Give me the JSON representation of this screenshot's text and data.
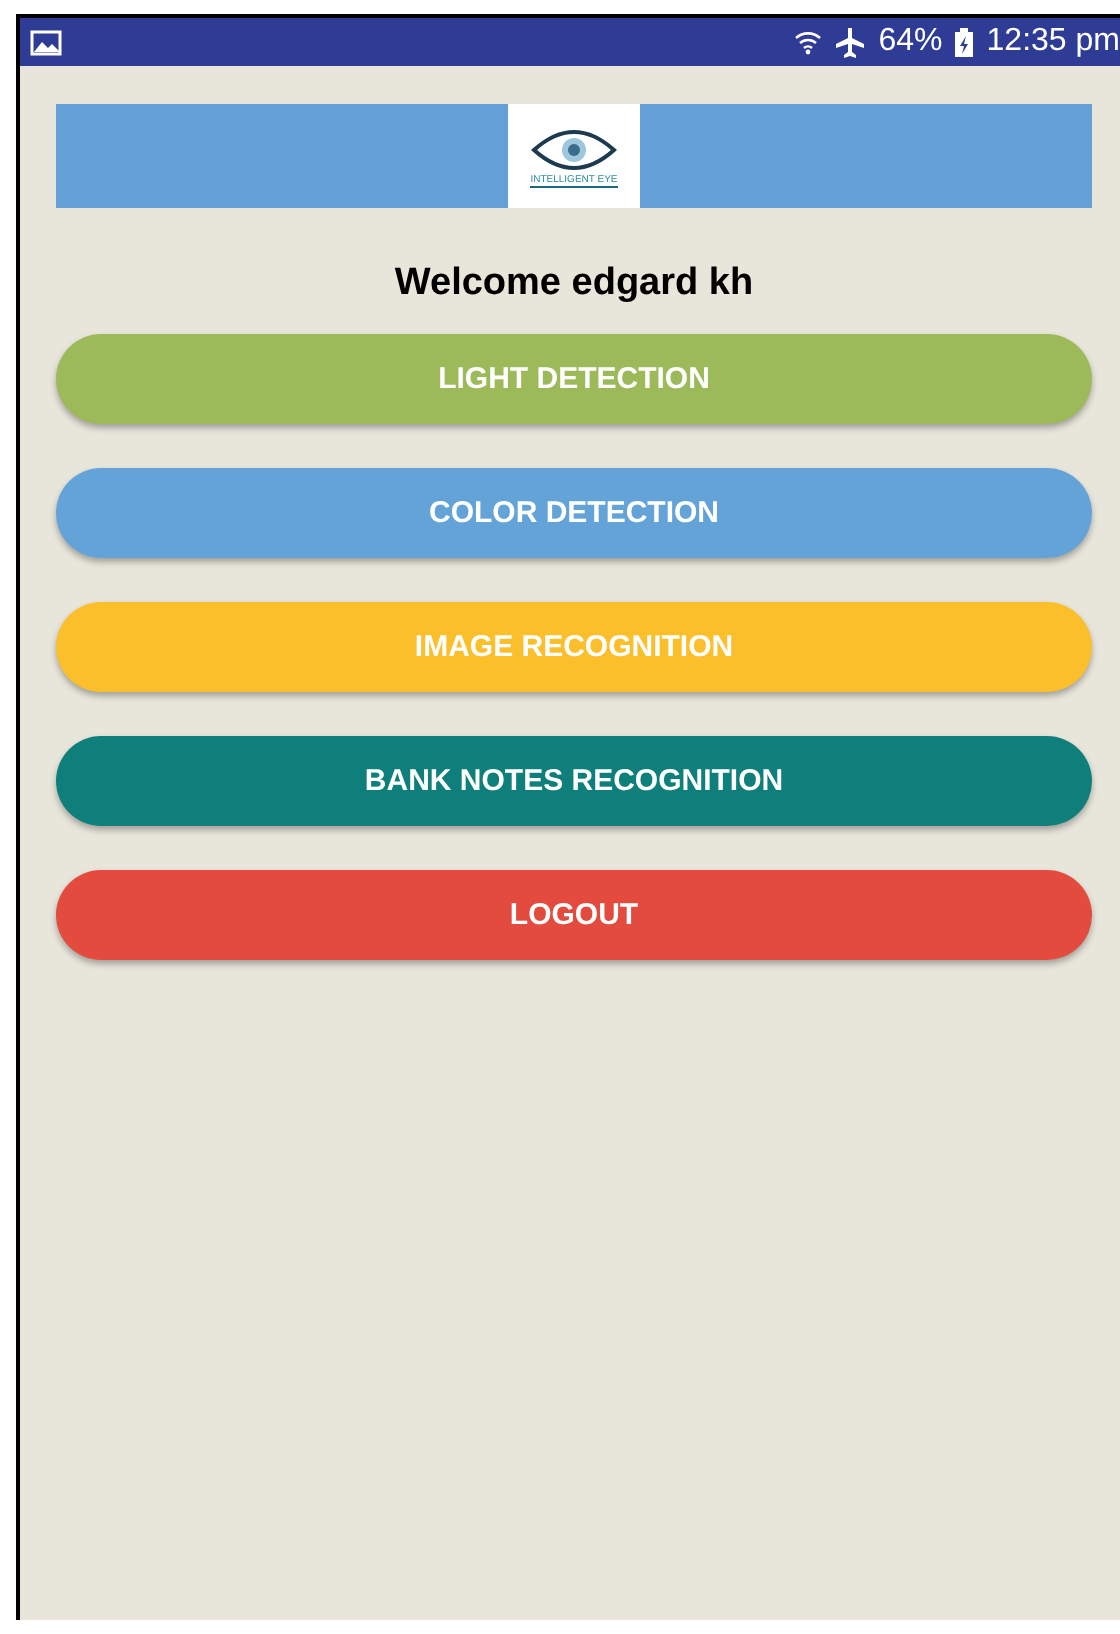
{
  "status_bar": {
    "battery": "64%",
    "time": "12:35 pm"
  },
  "header": {
    "logo_text": "INTELLIGENT EYE"
  },
  "welcome": "Welcome edgard kh",
  "buttons": [
    {
      "label": "LIGHT DETECTION",
      "color": "#9dba5a"
    },
    {
      "label": "COLOR DETECTION",
      "color": "#64a3d8"
    },
    {
      "label": "IMAGE RECOGNITION",
      "color": "#fbbf2c"
    },
    {
      "label": "BANK NOTES RECOGNITION",
      "color": "#0f7f7b"
    },
    {
      "label": "LOGOUT",
      "color": "#e24b3e"
    }
  ]
}
